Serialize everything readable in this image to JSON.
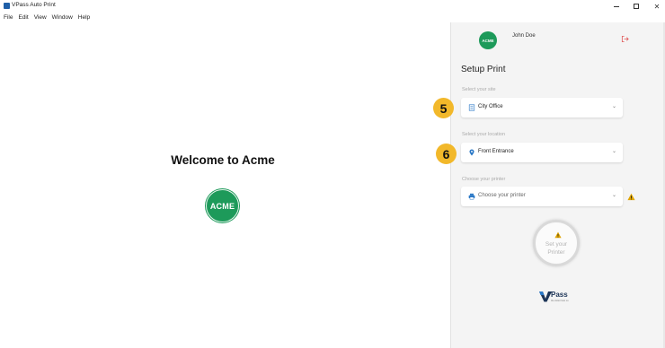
{
  "window": {
    "title": "VPass Auto Print"
  },
  "menu": [
    "File",
    "Edit",
    "View",
    "Window",
    "Help"
  ],
  "main": {
    "welcome": "Welcome to Acme",
    "logo_text": "ACME"
  },
  "panel": {
    "avatar_text": "ACME",
    "user_name": "John Doe",
    "setup_title": "Setup Print",
    "site": {
      "label": "Select your site",
      "value": "City Office",
      "icon": "building-icon"
    },
    "location": {
      "label": "Select your location",
      "value": "Front Entrance",
      "icon": "map-pin-icon"
    },
    "printer": {
      "label": "Choose your printer",
      "placeholder": "Choose your printer",
      "icon": "printer-icon"
    },
    "set_printer": {
      "line1": "Set your",
      "line2": "Printer"
    },
    "brand": {
      "word": "Pass",
      "tagline": "the visitor host co"
    },
    "badges": [
      "5",
      "6"
    ]
  },
  "colors": {
    "accent_green": "#1d9a5a",
    "badge_yellow": "#f2b82a",
    "warning": "#e0a400",
    "link_blue": "#2a78c6",
    "logout_red": "#e05a5a"
  }
}
